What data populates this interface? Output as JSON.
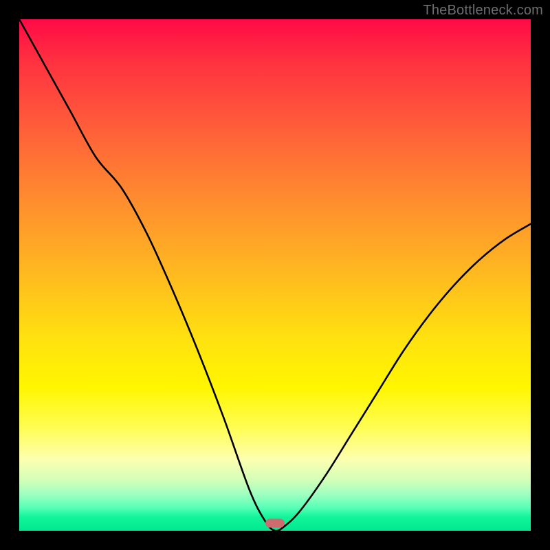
{
  "watermark": "TheBottleneck.com",
  "colors": {
    "frame_bg": "#000000",
    "curve_stroke": "#000000",
    "marker_fill": "#cf6a6f",
    "gradient_top": "#ff0a47",
    "gradient_bottom": "#00e890"
  },
  "chart_data": {
    "type": "line",
    "title": "",
    "xlabel": "",
    "ylabel": "",
    "xlim": [
      0,
      100
    ],
    "ylim": [
      0,
      100
    ],
    "x": [
      0,
      5,
      10,
      15,
      20,
      25,
      30,
      35,
      40,
      45,
      48,
      50,
      52,
      55,
      60,
      65,
      70,
      75,
      80,
      85,
      90,
      95,
      100
    ],
    "values": [
      100,
      91,
      82,
      73,
      67,
      58,
      47,
      35,
      22,
      8,
      2,
      0,
      1,
      4,
      11,
      19,
      27,
      35,
      42,
      48,
      53,
      57,
      60
    ],
    "optimum_x": 50,
    "marker": {
      "x": 50,
      "y": 1.5
    },
    "legend": null,
    "annotations": []
  }
}
